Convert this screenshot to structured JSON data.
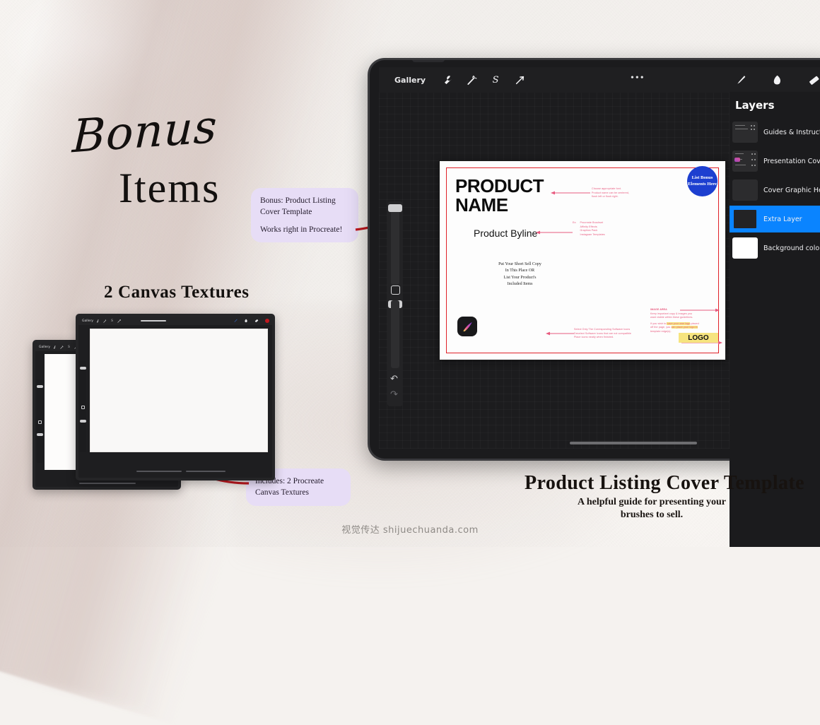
{
  "headline": {
    "line1": "Bonus",
    "line2": "Items",
    "textures_title": "2 Canvas Textures"
  },
  "callouts": {
    "bonus": {
      "line1": "Bonus: Product Listing",
      "line2": "Cover Template",
      "line3": "Works right in Procreate!"
    },
    "textures": {
      "line1": "Includes: 2 Procreate",
      "line2": "Canvas Textures"
    }
  },
  "footer": {
    "title": "Product Listing Cover Template",
    "subtitle_line1": "A helpful guide for presenting your",
    "subtitle_line2": "brushes to sell.",
    "watermark": "视觉传达   shijuechuanda.com"
  },
  "procreate": {
    "toolbar": {
      "gallery_label": "Gallery",
      "tools": [
        {
          "name": "wrench-icon",
          "glyph": "ὒ7"
        },
        {
          "name": "magic-wand-icon",
          "glyph": ""
        },
        {
          "name": "s-selection-icon",
          "glyph": "S"
        },
        {
          "name": "transform-arrow-icon",
          "glyph": ""
        }
      ],
      "overflow_label": "•••",
      "right_tools": [
        {
          "name": "brush-icon"
        },
        {
          "name": "smudge-icon"
        },
        {
          "name": "eraser-icon"
        }
      ]
    },
    "sidebar": {
      "undo_glyph": "↶",
      "redo_glyph": "↷"
    },
    "layers_panel": {
      "title": "Layers",
      "layers": [
        {
          "name": "Guides & Instructions",
          "selected": false,
          "thumb": "content"
        },
        {
          "name": "Presentation Cover",
          "selected": false,
          "thumb": "content2"
        },
        {
          "name": "Cover Graphic Here",
          "selected": false,
          "thumb": "empty"
        },
        {
          "name": "Extra Layer",
          "selected": true,
          "thumb": "empty"
        },
        {
          "name": "Background color",
          "selected": false,
          "thumb": "white"
        }
      ]
    }
  },
  "document": {
    "product_name_line1": "PRODUCT",
    "product_name_line2": "NAME",
    "byline": "Product Byline",
    "sell_copy_line1": "Put Your Short Sell Copy",
    "sell_copy_line2": "In This Place OR",
    "sell_copy_line3": "List Your Product's",
    "sell_copy_line4": "Included Items",
    "bonus_badge": "List Bonus Elements Here",
    "logo_label": "LOGO",
    "notes": {
      "font_note_line1": "Choose appropriate font.",
      "font_note_line2": "Product name can be centered,",
      "font_note_line3": "flush left or flush right.",
      "list_prefix": "Ex:",
      "list_items": [
        "Procreate Brushset",
        "Affinity Effects",
        "Graphics Pack",
        "Instagram Templates"
      ],
      "icons_note_line1": "Select Only The Corresponding Software Icons",
      "icons_note_line2": "Deselect Software Icons that are not compatible",
      "icons_note_line3": "Place icons neatly when finished.",
      "image_note_title": "IMAGE AREA",
      "image_note_line1": "Keep important copy & images you",
      "image_note_line2": "want visible within these guidelines.",
      "image_note_line3a": "If you wish to ",
      "image_note_highlight1": "have your own logo",
      "image_note_line3b": " placed",
      "image_note_line4a": "off the page, you ",
      "image_note_highlight2": "can place your logo in",
      "image_note_line5": "template edge(s)."
    }
  },
  "mini_ipads": {
    "gallery_label": "Gallery"
  },
  "colors": {
    "accent_blue": "#0a84ff",
    "badge_blue": "#1d3fd0",
    "guide_red": "#e02128",
    "note_pink": "#e85a7f",
    "callout_lavender": "#e7ddf6",
    "arrow_red": "#c0181f",
    "highlight_yellow": "#f6e47f",
    "paper": "#f5f2ef"
  }
}
